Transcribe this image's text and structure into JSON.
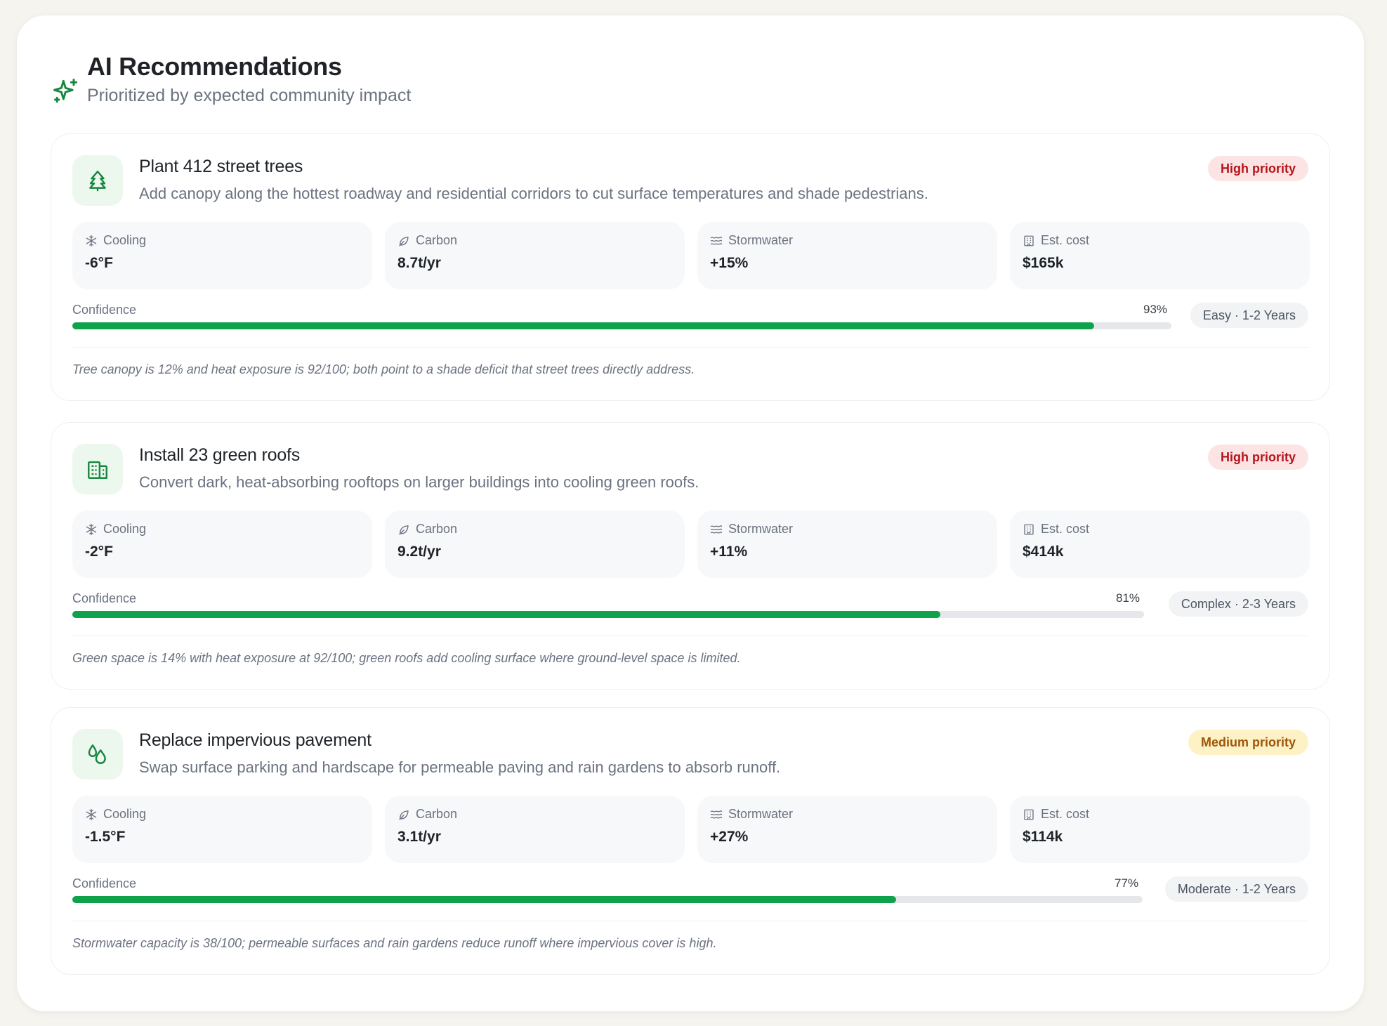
{
  "header": {
    "title": "AI Recommendations",
    "subtitle": "Prioritized by expected community impact",
    "icon": "sparkles-icon"
  },
  "colors": {
    "accent_green": "#0ea34a",
    "high_priority_bg": "#fde4e4",
    "high_priority_text": "#b5141b",
    "medium_priority_bg": "#fdf1c6",
    "medium_priority_text": "#a0560a"
  },
  "recommendations": [
    {
      "icon": "tree-icon",
      "title": "Plant 412 street trees",
      "description": "Add canopy along the hottest roadway and residential corridors to cut surface temperatures and shade pedestrians.",
      "priority": "High priority",
      "metrics": [
        {
          "label": "Cooling",
          "value": "-6°F",
          "icon": "snowflake-icon"
        },
        {
          "label": "Carbon",
          "value": "8.7t/yr",
          "icon": "leaf-icon"
        },
        {
          "label": "Stormwater",
          "value": "+15%",
          "icon": "waves-icon"
        },
        {
          "label": "Est. cost",
          "value": "$165k",
          "icon": "building-icon"
        }
      ],
      "confidence_label": "Confidence",
      "confidence_pct": "93%",
      "confidence": 0.93,
      "effort": "Easy · 1-2 Years",
      "rationale": "Tree canopy is 12% and heat exposure is 92/100; both point to a shade deficit that street trees directly address."
    },
    {
      "icon": "building-icon",
      "title": "Install 23 green roofs",
      "description": "Convert dark, heat-absorbing rooftops on larger buildings into cooling green roofs.",
      "priority": "High priority",
      "metrics": [
        {
          "label": "Cooling",
          "value": "-2°F",
          "icon": "snowflake-icon"
        },
        {
          "label": "Carbon",
          "value": "9.2t/yr",
          "icon": "leaf-icon"
        },
        {
          "label": "Stormwater",
          "value": "+11%",
          "icon": "waves-icon"
        },
        {
          "label": "Est. cost",
          "value": "$414k",
          "icon": "building-icon"
        }
      ],
      "confidence_label": "Confidence",
      "confidence_pct": "81%",
      "confidence": 0.81,
      "effort": "Complex · 2-3 Years",
      "rationale": "Green space is 14% with heat exposure at 92/100; green roofs add cooling surface where ground-level space is limited."
    },
    {
      "icon": "droplets-icon",
      "title": "Replace impervious pavement",
      "description": "Swap surface parking and hardscape for permeable paving and rain gardens to absorb runoff.",
      "priority": "Medium priority",
      "metrics": [
        {
          "label": "Cooling",
          "value": "-1.5°F",
          "icon": "snowflake-icon"
        },
        {
          "label": "Carbon",
          "value": "3.1t/yr",
          "icon": "leaf-icon"
        },
        {
          "label": "Stormwater",
          "value": "+27%",
          "icon": "waves-icon"
        },
        {
          "label": "Est. cost",
          "value": "$114k",
          "icon": "building-icon"
        }
      ],
      "confidence_label": "Confidence",
      "confidence_pct": "77%",
      "confidence": 0.77,
      "effort": "Moderate · 1-2 Years",
      "rationale": "Stormwater capacity is 38/100; permeable surfaces and rain gardens reduce runoff where impervious cover is high."
    }
  ]
}
